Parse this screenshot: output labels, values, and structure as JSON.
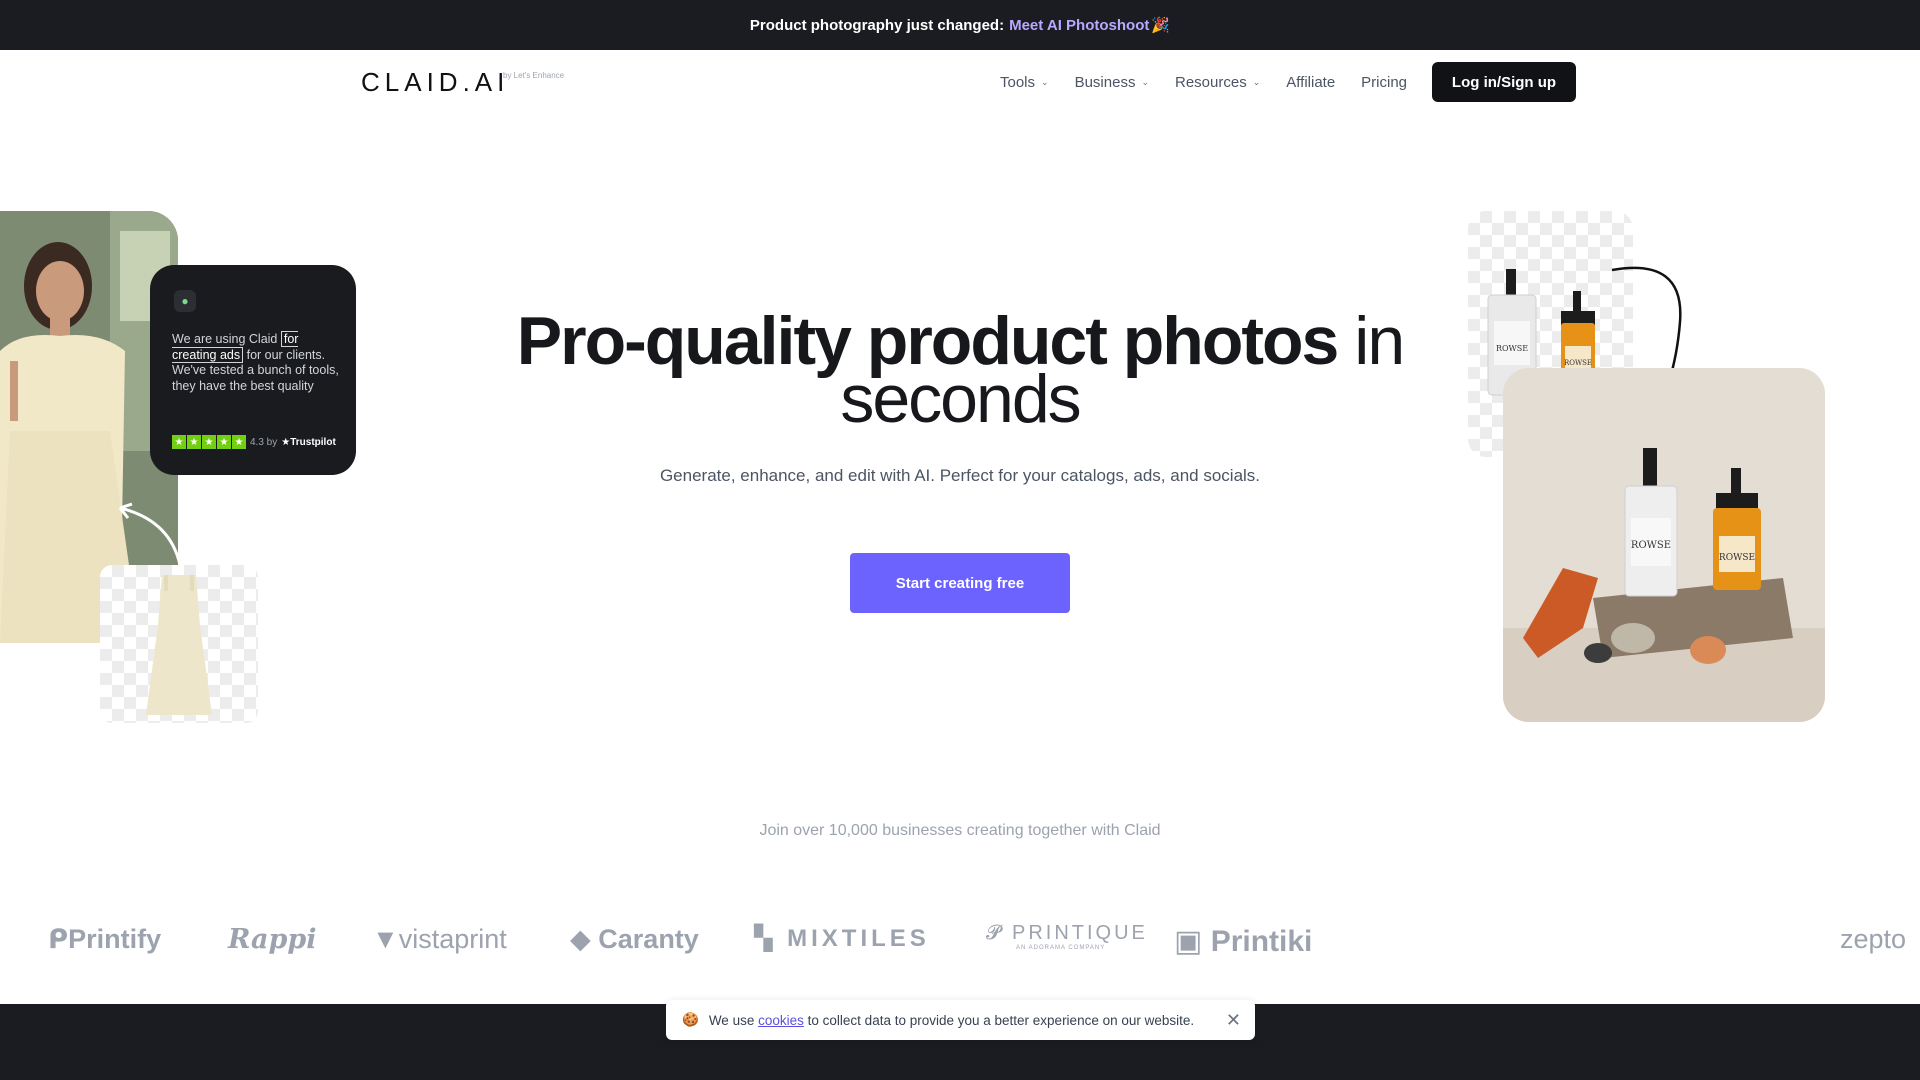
{
  "announcement": {
    "text": "Product photography just changed:",
    "link": "Meet AI Photoshoot",
    "emoji": "🎉"
  },
  "nav": {
    "logo": "CLAID.AI",
    "logo_sub": "by Let's Enhance",
    "items": [
      {
        "label": "Tools",
        "has_dropdown": true
      },
      {
        "label": "Business",
        "has_dropdown": true
      },
      {
        "label": "Resources",
        "has_dropdown": true
      },
      {
        "label": "Affiliate",
        "has_dropdown": false
      },
      {
        "label": "Pricing",
        "has_dropdown": false
      }
    ],
    "login": "Log in/Sign up"
  },
  "hero": {
    "title_bold": "Pro-quality product photos",
    "title_rest_1": "in",
    "title_rest_2": "seconds",
    "subtitle": "Generate, enhance, and edit with AI. Perfect for your catalogs, ads, and socials.",
    "cta": "Start creating free"
  },
  "review": {
    "quote_start": "We are using Claid",
    "quote_highlight": "for creating ads",
    "quote_end": "for our clients. We've tested a bunch of tools, they have the best quality",
    "rating": "4.3 by",
    "source": "Trustpilot"
  },
  "products": {
    "bottle_label": "ROWSE"
  },
  "social_proof": {
    "text": "Join over 10,000 businesses creating together with Claid",
    "brands": [
      "Printify",
      "Rappi",
      "vistaprint",
      "Caranty",
      "MIXTILES",
      "PRINTIQUE",
      "Printiki",
      "zepto"
    ],
    "printique_sub": "AN ADORAMA COMPANY"
  },
  "cookie": {
    "icon": "cookie-icon",
    "prefix": "We use",
    "link": "cookies",
    "suffix": "to collect data to provide you a better experience on our website."
  },
  "colors": {
    "accent": "#6c63ff",
    "dark": "#1b1c22",
    "link_purple": "#b9a8ff"
  }
}
